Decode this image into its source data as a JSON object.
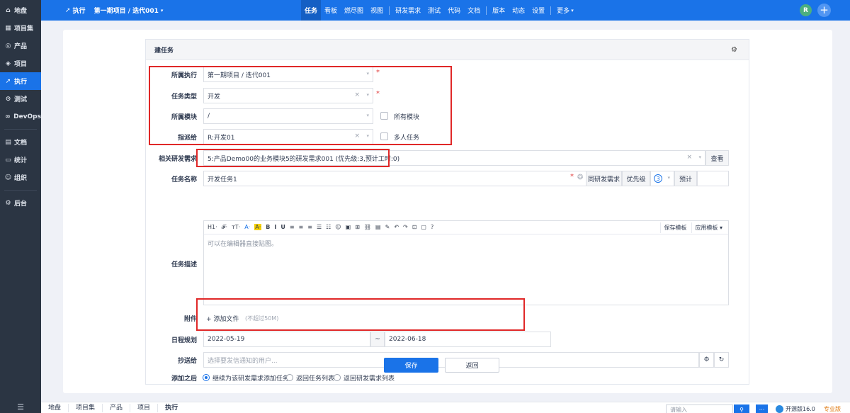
{
  "sidebar": {
    "items": [
      {
        "label": "地盘",
        "icon": "home-icon",
        "glyph": "⌂"
      },
      {
        "label": "项目集",
        "icon": "grid-icon",
        "glyph": "▦"
      },
      {
        "label": "产品",
        "icon": "location-pin-icon",
        "glyph": "◎"
      },
      {
        "label": "项目",
        "icon": "box-icon",
        "glyph": "◈"
      },
      {
        "label": "执行",
        "icon": "send-icon",
        "glyph": "➚",
        "active": true
      },
      {
        "label": "测试",
        "icon": "search-icon",
        "glyph": "⊙"
      },
      {
        "label": "DevOps",
        "icon": "infinity-icon",
        "glyph": "∞"
      },
      {
        "label": "文档",
        "icon": "document-icon",
        "glyph": "▤"
      },
      {
        "label": "统计",
        "icon": "monitor-icon",
        "glyph": "▭"
      },
      {
        "label": "组织",
        "icon": "users-icon",
        "glyph": "☺"
      },
      {
        "label": "后台",
        "icon": "gear-icon",
        "glyph": "⚙"
      }
    ],
    "toggle_glyph": "☰"
  },
  "header": {
    "section": "执行",
    "breadcrumb": "第一期项目 / 迭代001",
    "nav": [
      "任务",
      "看板",
      "燃尽图",
      "视图",
      "研发需求",
      "测试",
      "代码",
      "文档",
      "版本",
      "动态",
      "设置",
      "更多"
    ],
    "active_nav": "任务",
    "avatar": "R",
    "plus": "+"
  },
  "form": {
    "title": "建任务",
    "execution": {
      "label": "所属执行",
      "value": "第一期项目 / 迭代001"
    },
    "type": {
      "label": "任务类型",
      "value": "开发"
    },
    "module": {
      "label": "所属模块",
      "value": "/",
      "checkbox": "所有模块"
    },
    "assign": {
      "label": "指派给",
      "value": "R:开发01",
      "checkbox": "多人任务"
    },
    "story": {
      "label": "相关研发需求",
      "value": "5:产品Demo00的业务模块5的研发需求001 (优先级:3,预计工时:0)",
      "button": "查看"
    },
    "name": {
      "label": "任务名称",
      "value": "开发任务1",
      "same_story": "同研发需求",
      "priority_label": "优先级",
      "priority_value": "3",
      "estimate": "预计"
    },
    "desc": {
      "label": "任务描述",
      "placeholder": "可以在编辑器直接贴图。",
      "toolbar": [
        "H1·",
        "𝓕·",
        "тT·",
        "A·",
        "A·",
        "B",
        "I",
        "U",
        "≡",
        "≡",
        "≡",
        "☰",
        "☷",
        "☺",
        "▣",
        "⊞",
        "⛓",
        "▤",
        "✎",
        "↶",
        "↷",
        "⊡",
        "▢",
        "?"
      ],
      "save_template": "保存模板",
      "apply_template": "应用模板"
    },
    "attach": {
      "label": "附件",
      "button": "+ 添加文件",
      "hint": "(不超过50M)"
    },
    "schedule": {
      "label": "日程规划",
      "start": "2022-05-19",
      "separator": "~",
      "end": "2022-06-18"
    },
    "cc": {
      "label": "抄送给",
      "placeholder": "选择要发信通知的用户..."
    },
    "after": {
      "label": "添加之后",
      "options": [
        "继续为该研发需求添加任务",
        "返回任务列表",
        "返回研发需求列表"
      ],
      "selected": 0
    },
    "save": "保存",
    "back": "返回"
  },
  "bottombar": {
    "crumbs": [
      "地盘",
      "项目集",
      "产品",
      "项目",
      "执行"
    ],
    "search_placeholder": "请输入",
    "version": "开源版16.0",
    "pro": "专业版"
  },
  "colors": {
    "primary": "#1a73e8",
    "sidebar": "#2b3543",
    "annotation": "#e02828",
    "required": "#e03b3b"
  }
}
